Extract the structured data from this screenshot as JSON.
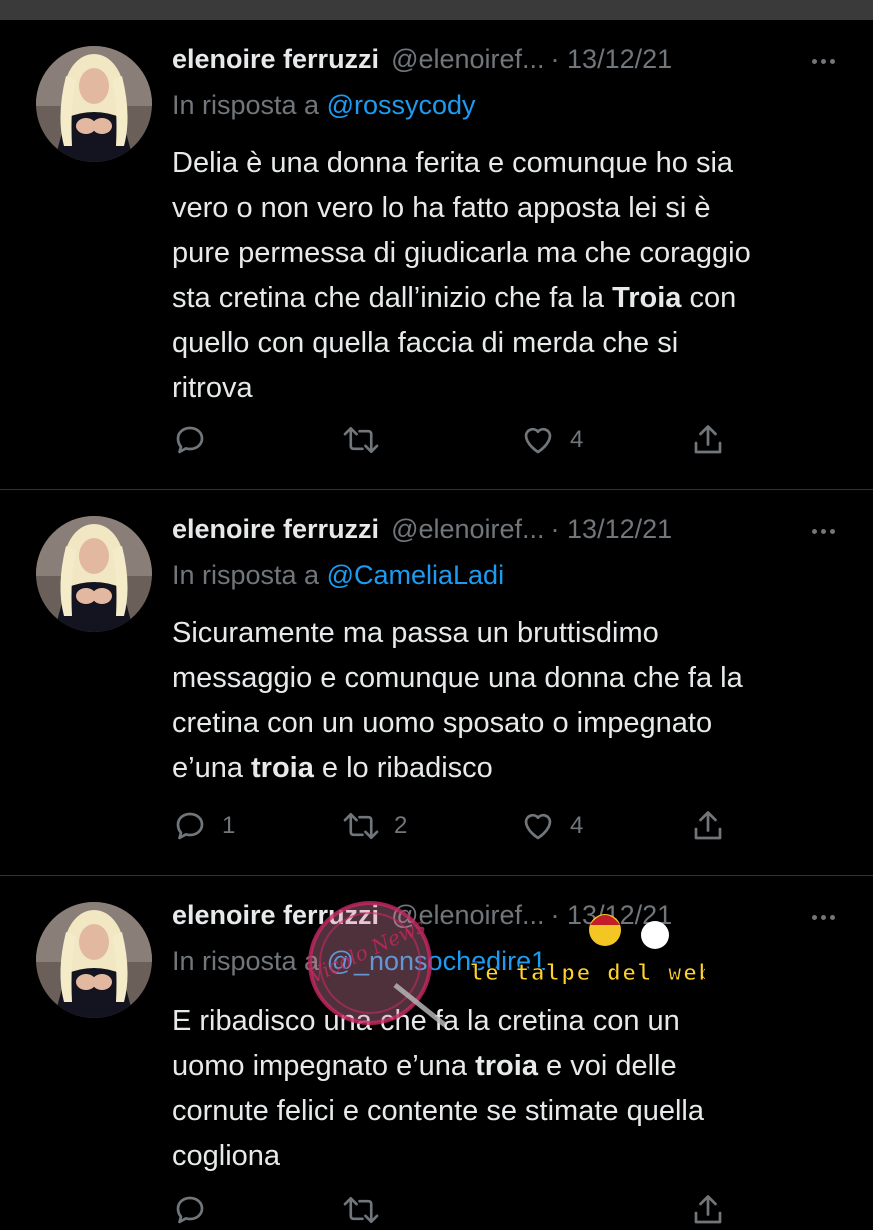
{
  "tweets": [
    {
      "name": "elenoire ferruzzi",
      "handle": "@elenoiref...",
      "date": "· 13/12/21",
      "reply_prefix": "In risposta a ",
      "reply_mention": "@rossycody",
      "text_lines": [
        "Delia è una donna ferita e comunque ho sia",
        "vero o non vero lo ha fatto apposta lei si è",
        "pure permessa di giudicarla ma che coraggio",
        "sta cretina che dall’inizio che fa la ",
        "Troia",
        " con",
        "quello con quella faccia di merda che si",
        "ritrova"
      ],
      "replies": "",
      "retweets": "",
      "likes": "4"
    },
    {
      "name": "elenoire ferruzzi",
      "handle": "@elenoiref...",
      "date": "· 13/12/21",
      "reply_prefix": "In risposta a ",
      "reply_mention": "@CameliaLadi",
      "text_lines": [
        "Sicuramente ma passa un bruttisdimo",
        "messaggio e comunque una donna che fa la",
        "cretina con un uomo sposato o impegnato",
        "e’una ",
        "troia",
        " e lo ribadisco"
      ],
      "replies": "1",
      "retweets": "2",
      "likes": "4"
    },
    {
      "name": "elenoire ferruzzi",
      "handle": "@elenoiref...",
      "date": "· 13/12/21",
      "reply_prefix": "In risposta a ",
      "reply_mention": "@_nonsochedire1",
      "text_lines": [
        "E ribadisco una che fa la cretina con un",
        "uomo impegnato e’una ",
        "troia",
        " e voi delle",
        "cornute felici e contente se stimate quella",
        "cogliona"
      ]
    }
  ],
  "watermark": {
    "stamp_text": "Vicolo News",
    "overlay_text": "le talpe del web"
  },
  "colors": {
    "background": "#000000",
    "text": "#e7e9ea",
    "secondary": "#71767b",
    "link": "#1d9bf0",
    "divider": "#2f3336"
  }
}
